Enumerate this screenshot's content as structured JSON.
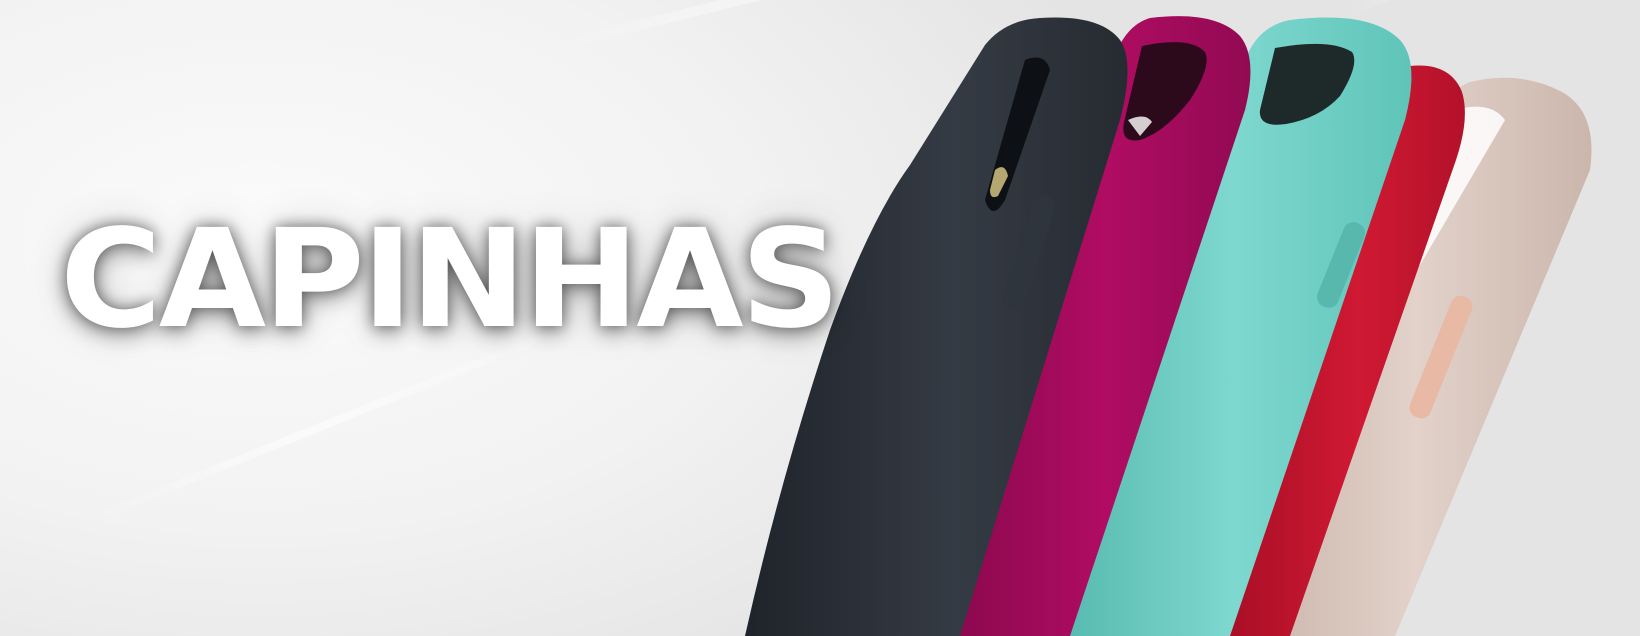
{
  "banner": {
    "title": "CAPINHAS"
  },
  "artwork": {
    "subject": "stack-of-silicone-phone-cases",
    "case_colors": [
      "#2b3038",
      "#a00a5a",
      "#6fcdc4",
      "#c8102e",
      "#d9c6bd"
    ]
  },
  "colors": {
    "background": "#f2f2f2",
    "title_text": "#ffffff"
  }
}
